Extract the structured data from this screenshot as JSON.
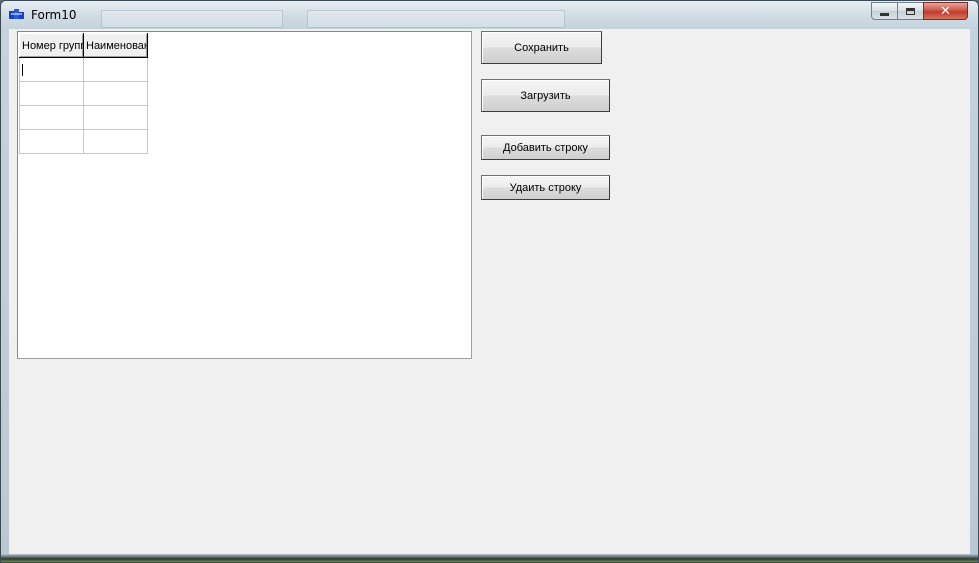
{
  "window": {
    "title": "Form10",
    "controls": {
      "minimize": "minimize",
      "maximize": "maximize",
      "close": "✕"
    },
    "icon": "delphi-app-icon"
  },
  "grid": {
    "columns": [
      "Номер групп",
      "Наименован"
    ],
    "rows": [
      [
        "",
        ""
      ],
      [
        "",
        ""
      ],
      [
        "",
        ""
      ],
      [
        "",
        ""
      ]
    ],
    "active_cell": {
      "row": 0,
      "col": 0
    }
  },
  "buttons": {
    "save": "Сохранить",
    "load": "Загрузить",
    "add_row": "Добавить строку",
    "delete_row": "Удаить строку"
  },
  "colors": {
    "client_bg": "#f0f0f0",
    "close_button": "#c23a2b"
  }
}
